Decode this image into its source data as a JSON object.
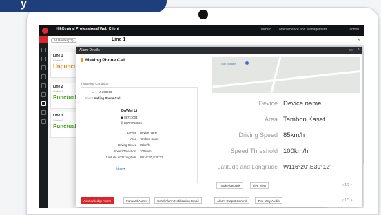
{
  "colors": {
    "brand_red": "#d9252b",
    "tag_blue": "#1e3f7c",
    "title_bar": "#121315",
    "unpunctual": "#e88b1e",
    "punctual": "#4ca322"
  },
  "corner_tag": {
    "text": "y"
  },
  "titlebar": {
    "app_title": "HikCentral Professional Web Client",
    "wizard": "Wizard",
    "maintenance": "Maintenance and Management",
    "user": "admin"
  },
  "listbar": {
    "filter": "All Routes(22)",
    "title": "Line 1"
  },
  "route_cards": [
    {
      "title": "Line 1",
      "sub": "Station1",
      "status": "Unpunctual",
      "status_color": "#e88b1e"
    },
    {
      "title": "Line 2",
      "sub": "Station1",
      "status": "Punctual",
      "status_color": "#4ca322"
    },
    {
      "title": "Line 3",
      "sub": "Station1",
      "status": "Punctual",
      "status_color": "#4ca322"
    }
  ],
  "modal": {
    "title": "Alarm Details",
    "alarm_name": "Making Phone Call",
    "trigger_label": "Triggering Condition",
    "plate": "M-290968",
    "event_label": "Event",
    "event_value": "Making Phone Call",
    "person": "DaWei Li",
    "id_number": "88721003",
    "phone": "18787768821",
    "device_label": "Device",
    "device_value": "Device name",
    "area_label": "Area",
    "area_value": "Tambon Kaset",
    "speed_label": "Driving Speed",
    "speed_value": "85km/h",
    "threshold_label": "Speed Threshold",
    "threshold_value": "100km/h",
    "latlng_label": "Latitude and Longitude",
    "latlng_value": "W116°20',E39°12'",
    "more": "More",
    "map_label": "Thai Theatre",
    "track_playback": "Track Playback",
    "live_view": "Live View",
    "pager": "< 1/3 >",
    "footer_pager": "< 1/3 >",
    "footer_buttons": [
      "Acknowledge Alarm",
      "Forward Alarm",
      "Send Alarm Notification Email",
      "Alarm Output Control",
      "Two-Way Audio"
    ]
  }
}
